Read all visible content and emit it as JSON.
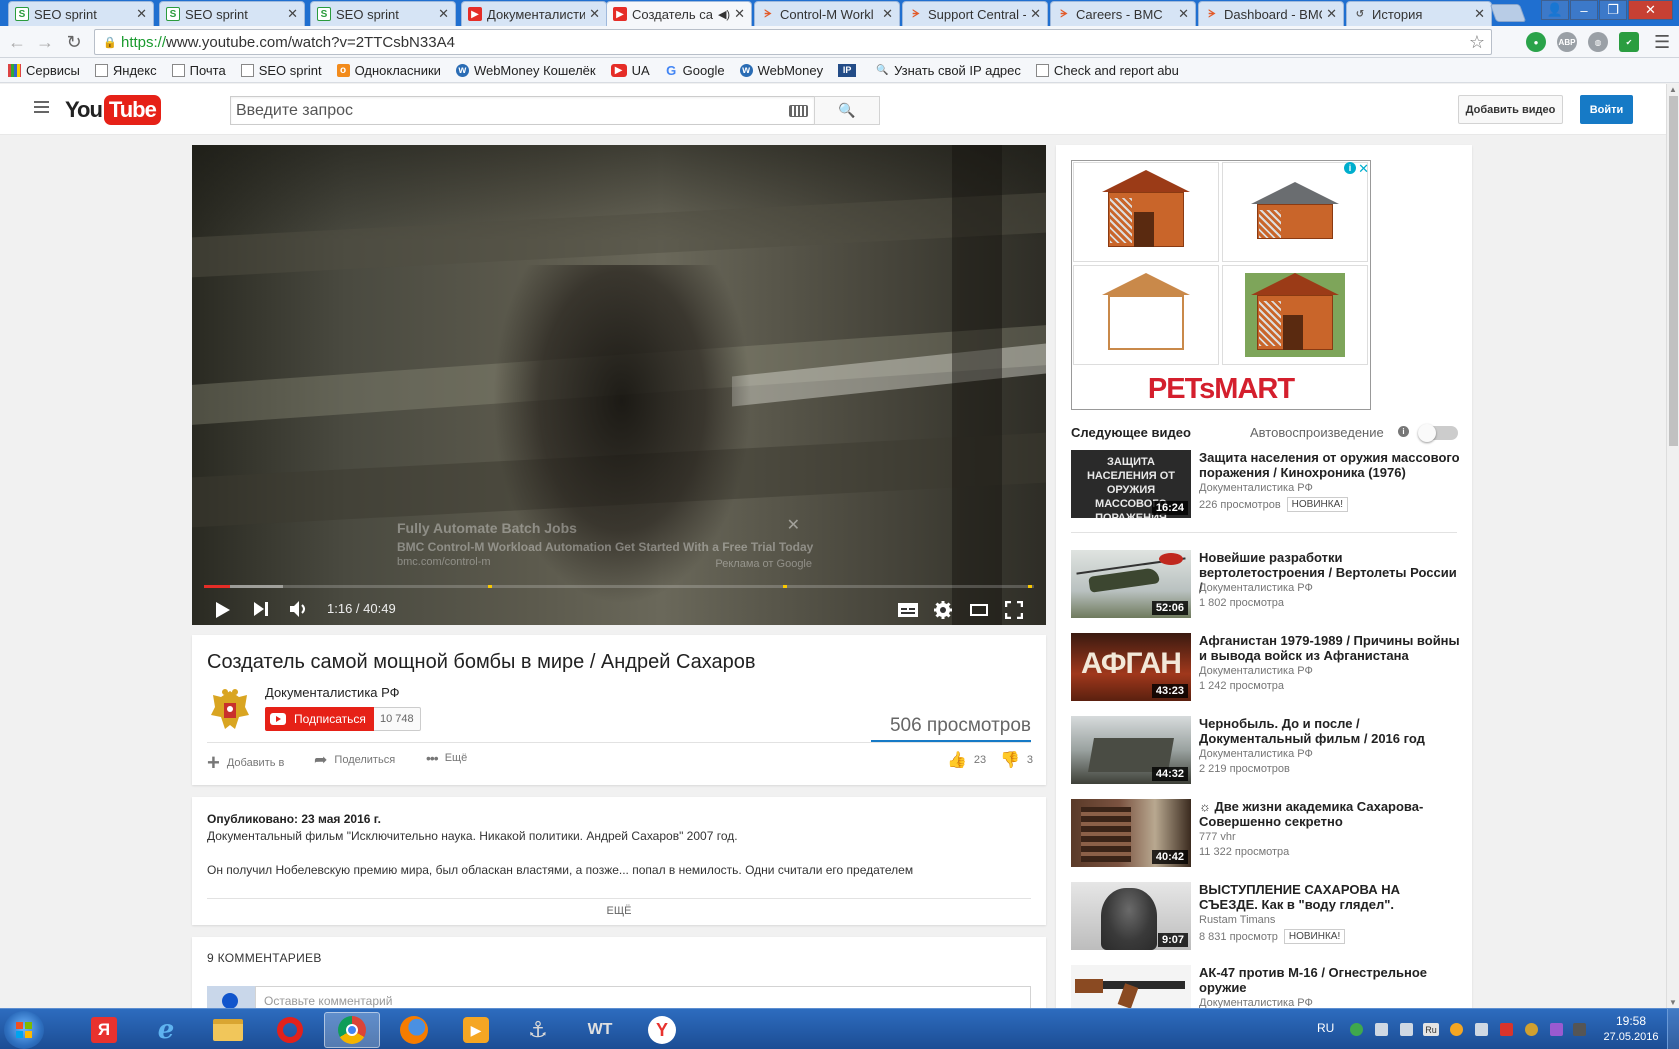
{
  "browser": {
    "tabs": [
      {
        "title": "SEO sprint",
        "favicon": "seo",
        "active": false
      },
      {
        "title": "SEO sprint",
        "favicon": "seo",
        "active": false
      },
      {
        "title": "SEO sprint",
        "favicon": "seo",
        "active": false
      },
      {
        "title": "Документалисти",
        "favicon": "youtube",
        "active": false
      },
      {
        "title": "Создатель са",
        "favicon": "youtube",
        "active": true
      },
      {
        "title": "Control-M Workl",
        "favicon": "bmc",
        "active": false
      },
      {
        "title": "Support Central -",
        "favicon": "bmc",
        "active": false
      },
      {
        "title": "Careers - BMC",
        "favicon": "bmc",
        "active": false
      },
      {
        "title": "Dashboard - BMC",
        "favicon": "bmc",
        "active": false
      },
      {
        "title": "История",
        "favicon": "history",
        "active": false
      }
    ],
    "url_scheme": "https://",
    "url_rest": "www.youtube.com/watch?v=2TTCsbN33A4",
    "extensions": [
      "ABP"
    ],
    "bookmarks": [
      {
        "label": "Сервисы",
        "icon": "apps-icon"
      },
      {
        "label": "Яндекс",
        "icon": "page-icon"
      },
      {
        "label": "Почта",
        "icon": "page-icon"
      },
      {
        "label": "SEO sprint",
        "icon": "seo-icon"
      },
      {
        "label": "Однокласники",
        "icon": "ok-icon"
      },
      {
        "label": "WebMoney Кошелёк",
        "icon": "webmoney-icon"
      },
      {
        "label": "UA",
        "icon": "youtube-icon"
      },
      {
        "label": "Google",
        "icon": "google-icon"
      },
      {
        "label": "WebMoney",
        "icon": "webmoney-icon"
      },
      {
        "label": "IP",
        "icon": "ip-icon"
      },
      {
        "label": "Узнать свой IP адрес",
        "icon": "search-icon"
      },
      {
        "label": "Check and report abu",
        "icon": "page-icon"
      }
    ]
  },
  "header": {
    "logo_you": "You",
    "logo_tube": "Tube",
    "search_placeholder": "Введите запрос",
    "upload_label": "Добавить видео",
    "signin_label": "Войти"
  },
  "player": {
    "ad_title": "Fully Automate Batch Jobs",
    "ad_description": "BMC Control-M Workload Automation Get Started With a Free Trial Today",
    "ad_url": "bmc.com/control-m",
    "ad_label": "Реклама от Google",
    "current_time": "1:16",
    "duration": "40:49",
    "time_display": "1:16 / 40:49",
    "played_fraction": 0.031,
    "buffered_fraction": 0.095,
    "ad_markers": [
      0.345,
      0.7,
      0.995
    ]
  },
  "video": {
    "title": "Создатель самой мощной бомбы в мире / Андрей Сахаров",
    "channel": "Документалистика РФ",
    "subscribe_label": "Подписаться",
    "subscriber_count": "10 748",
    "views": "506 просмотров",
    "actions": {
      "add_to": "Добавить в",
      "share": "Поделиться",
      "more": "Ещё",
      "likes": "23",
      "dislikes": "3"
    }
  },
  "description": {
    "published": "Опубликовано: 23 мая 2016 г.",
    "line1": "Документальный фильм \"Исключительно наука. Никакой политики. Андрей Сахаров\" 2007 год.",
    "line2": "Он получил Нобелевскую премию мира, был обласкан властями, а позже... попал в немилость. Одни считали его предателем",
    "more_label": "ЕЩЁ"
  },
  "comments": {
    "header": "9 КОММЕНТАРИЕВ",
    "placeholder": "Оставьте комментарий"
  },
  "sidebar": {
    "ad_brand": "PETsMART",
    "up_next_label": "Следующее видео",
    "autoplay_label": "Автовоспроизведение",
    "autoplay_on": false,
    "recommendations": [
      {
        "title": "Защита населения от оружия массового поражения / Кинохроника (1976)",
        "channel": "Документалистика РФ",
        "views": "226 просмотров",
        "badge": "НОВИНКА!",
        "duration": "16:24",
        "thumb_text": "ЗАЩИТА НАСЕЛЕНИЯ ОТ ОРУЖИЯ МАССОВОГО ПОРАЖЕНИЯ"
      },
      {
        "title": "Новейшие разработки вертолетостроения / Вертолеты России /",
        "channel": "Документалистика РФ",
        "views": "1 802 просмотра",
        "badge": "",
        "duration": "52:06",
        "thumb_text": ""
      },
      {
        "title": "Афганистан 1979-1989 / Причины войны и вывода войск из Афганистана",
        "channel": "Документалистика РФ",
        "views": "1 242 просмотра",
        "badge": "",
        "duration": "43:23",
        "thumb_text": "АФГАН"
      },
      {
        "title": "Чернобыль. До и после / Документальный фильм / 2016 год",
        "channel": "Документалистика РФ",
        "views": "2 219 просмотров",
        "badge": "",
        "duration": "44:32",
        "thumb_text": ""
      },
      {
        "title": "☼ Две жизни академика Сахарова-Совершенно секретно",
        "channel": "777 vhr",
        "views": "11 322 просмотра",
        "badge": "",
        "duration": "40:42",
        "thumb_text": ""
      },
      {
        "title": "ВЫСТУПЛЕНИЕ САХАРОВА НА СЪЕЗДЕ. Как в \"воду глядел\".",
        "channel": "Rustam Timans",
        "views": "8 831 просмотр",
        "badge": "НОВИНКА!",
        "duration": "9:07",
        "thumb_text": ""
      },
      {
        "title": "АК-47 против М-16 / Огнестрельное оружие",
        "channel": "Документалистика РФ",
        "views": "",
        "badge": "",
        "duration": "",
        "thumb_text": ""
      }
    ]
  },
  "taskbar": {
    "language": "RU",
    "time": "19:58",
    "date": "27.05.2016",
    "tray_lang": "Ru"
  },
  "colors": {
    "youtube_red": "#e62117",
    "signin_blue": "#167ac6",
    "progress_red": "#e52d27",
    "ad_marker": "#f9c900"
  }
}
